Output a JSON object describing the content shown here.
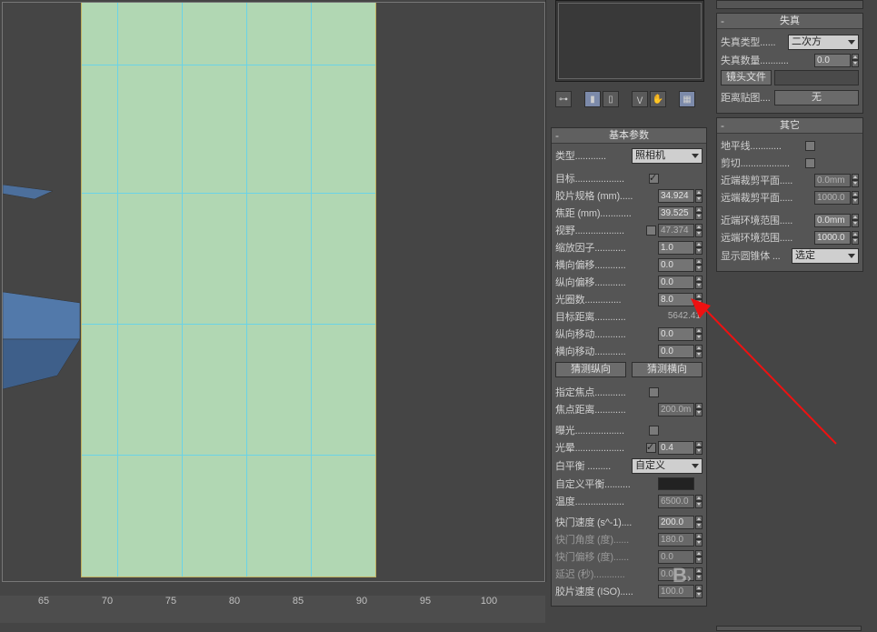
{
  "ruler": [
    "65",
    "70",
    "75",
    "80",
    "85",
    "90",
    "95",
    "100"
  ],
  "toolbar_icons": [
    "pin-icon",
    "bar-icon",
    "v1-icon",
    "v2-icon",
    "grid-icon"
  ],
  "panel_basic": {
    "title": "基本参数",
    "type_label": "类型............",
    "type_value": "照相机",
    "target_label": "目标...................",
    "film_label": "胶片规格 (mm).....",
    "film_value": "34.924",
    "focal_label": "焦距 (mm)............",
    "focal_value": "39.525",
    "fov_label": "视野...................",
    "fov_value": "47.374",
    "zoom_label": "缩放因子............",
    "zoom_value": "1.0",
    "hshift_label": "横向偏移............",
    "hshift_value": "0.0",
    "vshift_label": "纵向偏移............",
    "vshift_value": "0.0",
    "fstop_label": "光圈数..............",
    "fstop_value": "8.0",
    "tdist_label": "目标距离............",
    "tdist_value": "5642.41",
    "vmove_label": "纵向移动............",
    "vmove_value": "0.0",
    "hmove_label": "横向移动............",
    "hmove_value": "0.0",
    "guess_v": "猜测纵向",
    "guess_h": "猜测横向",
    "spec_focus_label": "指定焦点............",
    "focus_dist_label": "焦点距离............",
    "focus_dist_value": "200.0m",
    "expo_label": "曝光...................",
    "vig_label": "光晕...................",
    "vig_value": "0.4",
    "wb_label": "白平衡 .........",
    "wb_value": "自定义",
    "cust_wb_label": "自定义平衡..........",
    "temp_label": "温度...................",
    "temp_value": "6500.0",
    "shutter_label": "快门速度 (s^-1)....",
    "shutter_value": "200.0",
    "shangle_label": "快门角度 (度)......",
    "shangle_value": "180.0",
    "shoff_label": "快门偏移 (度)......",
    "shoff_value": "0.0",
    "delay_label": "延迟 (秒)............",
    "delay_value": "0.0",
    "iso_label": "胶片速度 (ISO).....",
    "iso_value": "100.0"
  },
  "panel_distort": {
    "title": "失真",
    "type_label": "失真类型......",
    "type_value": "二次方",
    "amount_label": "失真数量...........",
    "amount_value": "0.0",
    "lens_file_btn": "镜头文件",
    "dist_map_label": "距离贴图....",
    "dist_map_value": "无"
  },
  "panel_misc": {
    "title": "其它",
    "horizon_label": "地平线............",
    "clip_label": "剪切...................",
    "near_clip_label": "近端裁剪平面.....",
    "near_clip_value": "0.0mm",
    "far_clip_label": "远端裁剪平面.....",
    "far_clip_value": "1000.0",
    "near_env_label": "近端环境范围.....",
    "near_env_value": "0.0mm",
    "far_env_label": "远端环境范围.....",
    "far_env_value": "1000.0",
    "cone_label": "显示圆锥体 ...",
    "cone_value": "选定"
  }
}
